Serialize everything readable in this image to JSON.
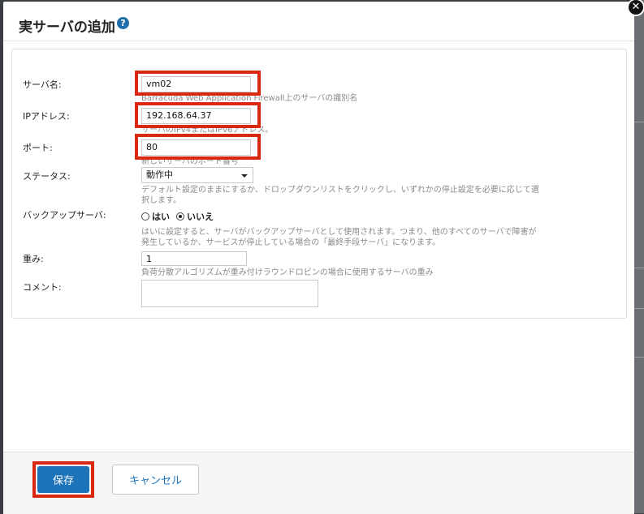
{
  "dialog": {
    "title": "実サーバの追加",
    "help_glyph": "?",
    "close_glyph": "✕"
  },
  "form": {
    "server_name": {
      "label": "サーバ名:",
      "value": "vm02",
      "help": "Barracuda Web Application Firewall上のサーバの識別名"
    },
    "ip_address": {
      "label": "IPアドレス:",
      "value": "192.168.64.37",
      "help": "サーバのIPv4またはIPv6アドレス。"
    },
    "port": {
      "label": "ポート:",
      "value": "80",
      "help": "新しいサーバのポート番号"
    },
    "status": {
      "label": "ステータス:",
      "selected": "動作中",
      "help": "デフォルト設定のままにするか、ドロップダウンリストをクリックし、いずれかの停止設定を必要に応じて選択します。"
    },
    "backup_server": {
      "label": "バックアップサーバ:",
      "options": [
        "はい",
        "いいえ"
      ],
      "selected": "いいえ",
      "help": "はいに設定すると、サーバがバックアップサーバとして使用されます。つまり、他のすべてのサーバで障害が発生しているか、サービスが停止している場合の「最終手段サーバ」になります。"
    },
    "weight": {
      "label": "重み:",
      "value": "1",
      "help": "負荷分散アルゴリズムが重み付けラウンドロビンの場合に使用するサーバの重み"
    },
    "comment": {
      "label": "コメント:",
      "value": ""
    }
  },
  "footer": {
    "save_label": "保存",
    "cancel_label": "キャンセル"
  },
  "colors": {
    "highlight": "#d9280f",
    "primary": "#1d73b8"
  }
}
